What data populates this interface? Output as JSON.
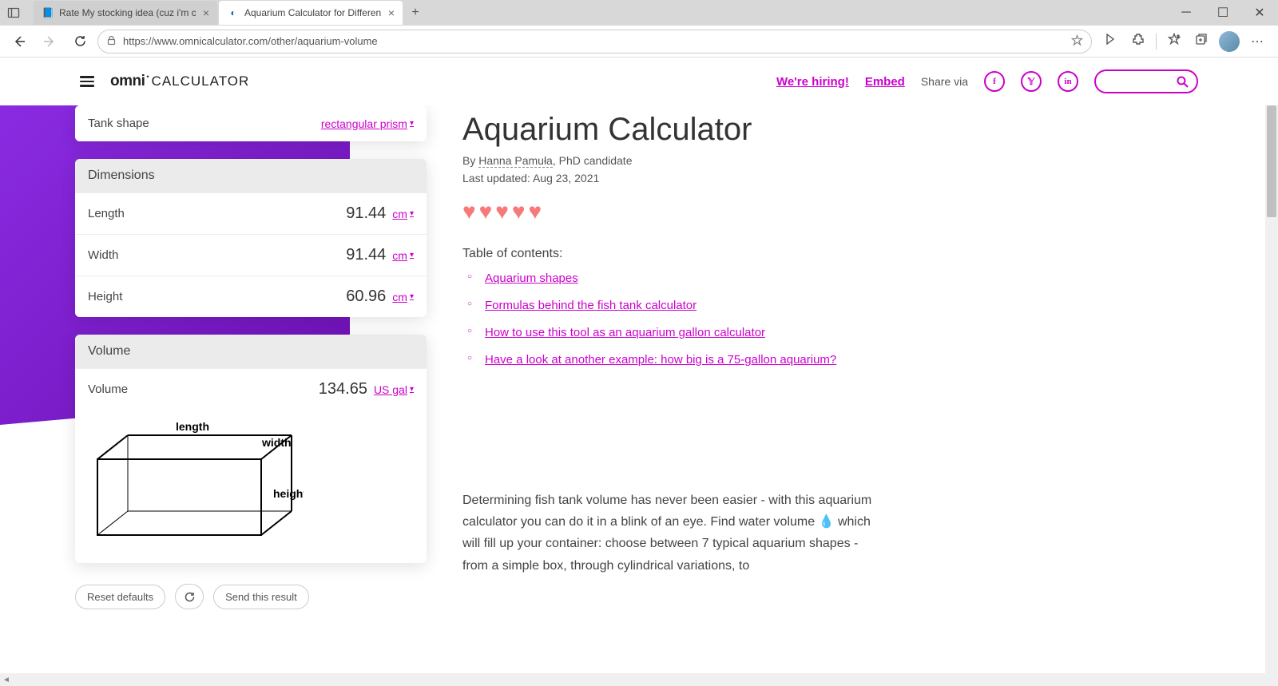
{
  "browser": {
    "tabs": [
      {
        "title": "Rate My stocking idea (cuz i'm c"
      },
      {
        "title": "Aquarium Calculator for Differen"
      }
    ],
    "url": "https://www.omnicalculator.com/other/aquarium-volume"
  },
  "header": {
    "logo_brand": "omni",
    "logo_text": "CALCULATOR",
    "hiring": "We're hiring!",
    "embed": "Embed",
    "share": "Share via"
  },
  "calc": {
    "shape_label": "Tank shape",
    "shape_value": "rectangular prism",
    "dims_header": "Dimensions",
    "length_label": "Length",
    "length_value": "91.44",
    "length_unit": "cm",
    "width_label": "Width",
    "width_value": "91.44",
    "width_unit": "cm",
    "height_label": "Height",
    "height_value": "60.96",
    "height_unit": "cm",
    "vol_header": "Volume",
    "vol_label": "Volume",
    "vol_value": "134.65",
    "vol_unit": "US gal",
    "diagram": {
      "length": "length",
      "width": "width",
      "height": "height"
    },
    "reset": "Reset defaults",
    "send": "Send this result"
  },
  "article": {
    "title": "Aquarium Calculator",
    "by": "By ",
    "author": "Hanna Pamuła",
    "author_suffix": ", PhD candidate",
    "updated": "Last updated: Aug 23, 2021",
    "toc_title": "Table of contents:",
    "toc": [
      "Aquarium shapes",
      "Formulas behind the fish tank calculator",
      "How to use this tool as an aquarium gallon calculator",
      "Have a look at another example: how big is a 75-gallon aquarium?"
    ],
    "body": "Determining fish tank volume has never been easier - with this aquarium calculator you can do it in a blink of an eye. Find water volume 💧 which will fill up your container: choose between 7 typical aquarium shapes - from a simple box, through cylindrical variations, to"
  }
}
